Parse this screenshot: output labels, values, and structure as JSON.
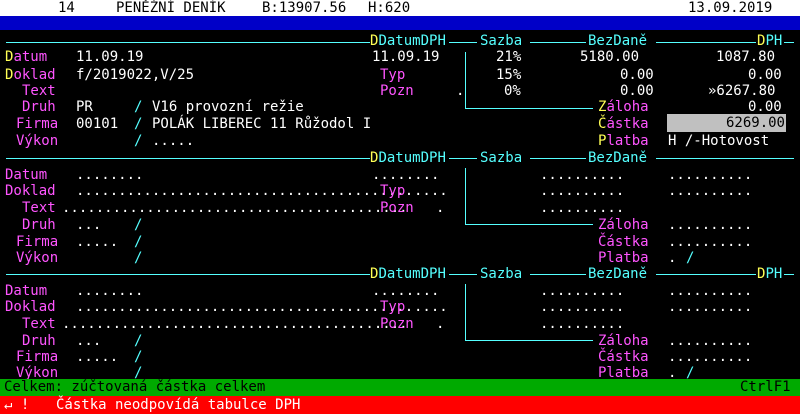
{
  "header": {
    "number": "14",
    "title": "PENĚŽNÍ DENÍK",
    "balance_label": "B:13907.56",
    "h_label": "H:620",
    "date": "13.09.2019"
  },
  "columns": {
    "datum_dph": "DatumDPH",
    "sazba": "Sazba",
    "bez_dane": "BezDaně",
    "dph": "DPH"
  },
  "labels": {
    "datum": "Datum",
    "doklad": "Doklad",
    "text": "Text",
    "druh": "Druh",
    "firma": "Firma",
    "vykon": "Výkon",
    "typ": "Typ",
    "pozn": "Pozn",
    "zaloha": "Záloha",
    "castka": "Částka",
    "platba": "Platba"
  },
  "record1": {
    "datum": "11.09.19",
    "doklad": "f/2019022,V/25",
    "druh_code": "PR",
    "druh_slash": "/",
    "druh_text": "V16 provozní režie",
    "firma_code": "00101",
    "firma_slash": "/",
    "firma_text": "POLÁK LIBEREC 11 Růžodol I",
    "vykon_slash": "/",
    "vykon_text": ".....",
    "datum_dph": "11.09.19",
    "typ_dot": ".",
    "rates": [
      {
        "sazba": "21%",
        "bez": "5180.00",
        "dph": "1087.80"
      },
      {
        "sazba": "15%",
        "bez": "0.00",
        "dph": "0.00"
      },
      {
        "sazba": "0%",
        "bez": "0.00",
        "dph": "»6267.80"
      }
    ],
    "zaloha": "0.00",
    "castka": "6269.00",
    "platba_value": "H /-Hotovost"
  },
  "empty_record": {
    "datum": "........",
    "doklad": "........................................",
    "text": ".........................................",
    "druh_dots": "...",
    "firma_dots": ".....",
    "slash": "/",
    "dph_date": "........",
    "typ_dots": "....",
    "pozn_dots": ".",
    "bez_dots": "..........",
    "dph_dots": "..........",
    "platba_dot": ".",
    "platba_slash": "/"
  },
  "status": {
    "text": "Celkem: zúčtovaná částka celkem",
    "shortcut": "CtrlF1"
  },
  "error": {
    "icon": "↵ !",
    "text": "Částka neodpovídá tabulce DPH"
  }
}
